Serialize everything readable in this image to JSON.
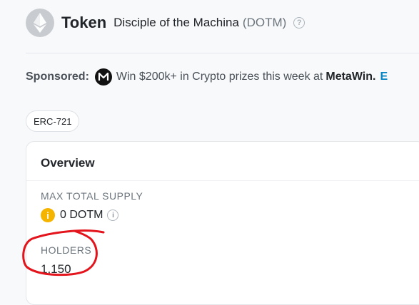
{
  "header": {
    "title": "Token",
    "token_name": "Disciple of the Machina",
    "token_symbol": "(DOTM)",
    "logo_icon": "ethereum-logo-icon",
    "help_icon": "question-circle-icon",
    "help_glyph": "?"
  },
  "sponsored": {
    "label": "Sponsored:",
    "logo_icon": "metawin-logo-icon",
    "text": "Win $200k+ in Crypto prizes this week at",
    "brand": "MetaWin.",
    "link_text": "E"
  },
  "badge": {
    "label": "ERC-721"
  },
  "overview": {
    "title": "Overview",
    "max_supply_label": "MAX TOTAL SUPPLY",
    "max_supply_value": "0 DOTM",
    "info_glyph": "i",
    "holders_label": "HOLDERS",
    "holders_value": "1,150"
  },
  "colors": {
    "annotation": "#e3141c",
    "link": "#0784c3",
    "coin": "#f5b400"
  }
}
